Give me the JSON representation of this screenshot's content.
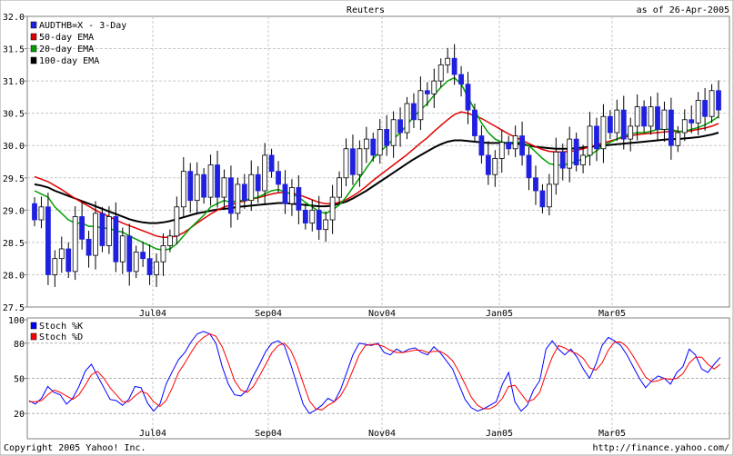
{
  "header": {
    "title": "Reuters",
    "date": "as of 26-Apr-2005"
  },
  "footer": {
    "copyright": "Copyright 2005 Yahoo! Inc.",
    "url": "http://finance.yahoo.com/"
  },
  "colors": {
    "candle_up": "#ffffff",
    "candle_down": "#2020e0",
    "ema50": "#e00000",
    "ema20": "#00a000",
    "ema100": "#000000",
    "stochK": "#0000ff",
    "stochD": "#ff0000"
  },
  "chart_data": [
    {
      "type": "candlestick",
      "x_ticks": [
        "Jul04",
        "Sep04",
        "Nov04",
        "Jan05",
        "Mar05"
      ],
      "y_ticks": [
        "27.5",
        "28.0",
        "28.5",
        "29.0",
        "29.5",
        "30.0",
        "30.5",
        "31.0",
        "31.5",
        "32.0"
      ],
      "ylim": [
        27.5,
        32.0
      ],
      "grid": true,
      "legend_position": "top-left",
      "legend": [
        "AUDTHB=X - 3-Day",
        "50-day EMA",
        "20-day EMA",
        "100-day EMA"
      ],
      "candles_open": [
        29.1,
        28.85,
        29.05,
        28.0,
        28.25,
        28.4,
        28.05,
        28.9,
        28.55,
        28.3,
        28.95,
        28.45,
        28.9,
        28.2,
        28.6,
        28.05,
        28.35,
        28.25,
        28.0,
        28.2,
        28.45,
        28.6,
        29.05,
        29.6,
        29.15,
        29.55,
        29.2,
        29.7,
        29.2,
        29.5,
        28.95,
        29.4,
        29.15,
        29.55,
        29.3,
        29.85,
        29.6,
        29.4,
        29.1,
        29.35,
        29.0,
        28.8,
        29.0,
        28.7,
        28.85,
        29.2,
        29.5,
        29.95,
        29.55,
        29.95,
        30.1,
        29.85,
        30.25,
        30.0,
        30.4,
        30.2,
        30.65,
        30.4,
        30.85,
        30.8,
        31.0,
        31.25,
        31.35,
        31.1,
        30.95,
        30.55,
        30.15,
        29.85,
        29.55,
        29.8,
        30.05,
        29.95,
        30.15,
        29.85,
        29.5,
        29.3,
        29.05,
        29.4,
        29.9,
        29.65,
        30.1,
        29.7,
        29.85,
        30.3,
        29.95,
        30.45,
        30.2,
        30.55,
        30.1,
        30.3,
        30.6,
        30.3,
        30.6,
        30.25,
        30.55,
        30.0,
        30.2,
        30.4,
        30.35,
        30.7,
        30.45,
        30.85
      ],
      "candles_close": [
        28.85,
        29.05,
        28.0,
        28.25,
        28.4,
        28.05,
        28.9,
        28.55,
        28.3,
        28.95,
        28.45,
        28.9,
        28.2,
        28.6,
        28.05,
        28.35,
        28.25,
        28.0,
        28.2,
        28.45,
        28.6,
        29.05,
        29.6,
        29.15,
        29.55,
        29.2,
        29.7,
        29.2,
        29.5,
        28.95,
        29.4,
        29.15,
        29.55,
        29.3,
        29.85,
        29.6,
        29.4,
        29.1,
        29.35,
        29.0,
        28.8,
        29.0,
        28.7,
        28.85,
        29.2,
        29.5,
        29.95,
        29.55,
        29.95,
        30.1,
        29.85,
        30.25,
        30.0,
        30.4,
        30.2,
        30.65,
        30.4,
        30.85,
        30.8,
        31.0,
        31.25,
        31.35,
        31.1,
        30.95,
        30.55,
        30.15,
        29.85,
        29.55,
        29.8,
        30.05,
        29.95,
        30.15,
        29.85,
        29.5,
        29.3,
        29.05,
        29.4,
        29.9,
        29.65,
        30.1,
        29.7,
        29.85,
        30.3,
        29.95,
        30.45,
        30.2,
        30.55,
        30.1,
        30.3,
        30.6,
        30.3,
        30.6,
        30.25,
        30.55,
        30.0,
        30.2,
        30.4,
        30.35,
        30.7,
        30.45,
        30.85,
        30.55
      ],
      "ema20": [
        29.3,
        29.25,
        29.2,
        29.05,
        28.95,
        28.85,
        28.8,
        28.8,
        28.75,
        28.75,
        28.72,
        28.72,
        28.68,
        28.66,
        28.6,
        28.55,
        28.5,
        28.45,
        28.4,
        28.38,
        28.4,
        28.48,
        28.6,
        28.72,
        28.82,
        28.92,
        29.05,
        29.1,
        29.15,
        29.12,
        29.15,
        29.15,
        29.18,
        29.2,
        29.25,
        29.3,
        29.32,
        29.28,
        29.25,
        29.2,
        29.12,
        29.05,
        28.98,
        28.95,
        29.0,
        29.08,
        29.2,
        29.35,
        29.5,
        29.65,
        29.8,
        29.9,
        30.0,
        30.1,
        30.2,
        30.32,
        30.45,
        30.55,
        30.65,
        30.78,
        30.9,
        31.0,
        31.05,
        30.95,
        30.75,
        30.55,
        30.35,
        30.2,
        30.1,
        30.05,
        30.05,
        30.05,
        30.05,
        30.0,
        29.9,
        29.8,
        29.72,
        29.7,
        29.7,
        29.72,
        29.75,
        29.8,
        29.85,
        29.92,
        30.0,
        30.05,
        30.1,
        30.15,
        30.18,
        30.2,
        30.2,
        30.22,
        30.25,
        30.25,
        30.25,
        30.22,
        30.22,
        30.25,
        30.28,
        30.32,
        30.38,
        30.45
      ],
      "ema50": [
        29.52,
        29.48,
        29.44,
        29.38,
        29.32,
        29.25,
        29.18,
        29.12,
        29.06,
        29.0,
        28.95,
        28.9,
        28.85,
        28.8,
        28.76,
        28.72,
        28.68,
        28.64,
        28.6,
        28.58,
        28.58,
        28.6,
        28.65,
        28.72,
        28.8,
        28.87,
        28.94,
        29.0,
        29.05,
        29.08,
        29.12,
        29.14,
        29.17,
        29.19,
        29.22,
        29.25,
        29.27,
        29.27,
        29.26,
        29.24,
        29.2,
        29.16,
        29.12,
        29.1,
        29.1,
        29.12,
        29.16,
        29.22,
        29.29,
        29.37,
        29.46,
        29.54,
        29.62,
        29.7,
        29.78,
        29.86,
        29.95,
        30.04,
        30.12,
        30.22,
        30.31,
        30.4,
        30.48,
        30.52,
        30.5,
        30.46,
        30.42,
        30.36,
        30.3,
        30.24,
        30.18,
        30.13,
        30.08,
        30.03,
        29.98,
        29.94,
        29.91,
        29.9,
        29.9,
        29.91,
        29.92,
        29.95,
        29.98,
        30.01,
        30.04,
        30.07,
        30.1,
        30.13,
        30.15,
        30.17,
        30.18,
        30.19,
        30.2,
        30.21,
        30.22,
        30.22,
        30.22,
        30.23,
        30.25,
        30.27,
        30.3,
        30.34
      ],
      "ema100": [
        29.4,
        29.38,
        29.35,
        29.3,
        29.26,
        29.22,
        29.18,
        29.14,
        29.1,
        29.06,
        29.02,
        28.98,
        28.94,
        28.9,
        28.86,
        28.83,
        28.81,
        28.8,
        28.8,
        28.81,
        28.83,
        28.86,
        28.89,
        28.92,
        28.95,
        28.97,
        28.99,
        29.01,
        29.02,
        29.03,
        29.05,
        29.06,
        29.07,
        29.08,
        29.09,
        29.1,
        29.11,
        29.11,
        29.1,
        29.09,
        29.08,
        29.07,
        29.06,
        29.06,
        29.07,
        29.1,
        29.13,
        29.18,
        29.24,
        29.3,
        29.37,
        29.44,
        29.51,
        29.58,
        29.65,
        29.72,
        29.79,
        29.85,
        29.91,
        29.97,
        30.02,
        30.06,
        30.08,
        30.08,
        30.07,
        30.06,
        30.05,
        30.04,
        30.04,
        30.04,
        30.04,
        30.03,
        30.02,
        30.0,
        29.98,
        29.97,
        29.96,
        29.95,
        29.95,
        29.95,
        29.96,
        29.97,
        29.98,
        29.99,
        30.0,
        30.01,
        30.02,
        30.03,
        30.04,
        30.05,
        30.06,
        30.07,
        30.08,
        30.09,
        30.1,
        30.1,
        30.11,
        30.12,
        30.13,
        30.15,
        30.17,
        30.2
      ]
    },
    {
      "type": "line",
      "y_ticks": [
        "20",
        "50",
        "80",
        "100"
      ],
      "ylim": [
        0,
        100
      ],
      "grid": true,
      "legend_position": "top-left",
      "series": [
        {
          "name": "Stoch %K",
          "values": [
            31,
            28,
            33,
            43,
            38,
            36,
            28,
            33,
            43,
            56,
            62,
            52,
            42,
            32,
            31,
            27,
            32,
            43,
            42,
            29,
            22,
            28,
            45,
            56,
            66,
            72,
            81,
            88,
            90,
            88,
            80,
            60,
            45,
            36,
            35,
            40,
            52,
            62,
            73,
            80,
            82,
            78,
            62,
            45,
            28,
            20,
            23,
            27,
            33,
            30,
            40,
            55,
            70,
            80,
            79,
            78,
            80,
            72,
            70,
            75,
            72,
            75,
            76,
            72,
            70,
            77,
            72,
            65,
            58,
            45,
            32,
            25,
            22,
            24,
            27,
            30,
            45,
            55,
            30,
            22,
            27,
            40,
            48,
            75,
            82,
            75,
            70,
            75,
            68,
            58,
            50,
            62,
            78,
            85,
            82,
            78,
            70,
            60,
            50,
            42,
            48,
            52,
            50,
            45,
            55,
            60,
            75,
            70,
            58,
            55,
            62,
            68
          ]
        },
        {
          "name": "Stoch %D",
          "values": [
            30,
            30,
            31,
            36,
            40,
            38,
            35,
            32,
            36,
            44,
            53,
            56,
            50,
            42,
            36,
            30,
            30,
            35,
            39,
            37,
            30,
            26,
            31,
            42,
            55,
            63,
            72,
            80,
            85,
            88,
            86,
            77,
            63,
            48,
            40,
            38,
            43,
            52,
            62,
            72,
            78,
            80,
            74,
            62,
            46,
            31,
            24,
            23,
            27,
            30,
            35,
            44,
            57,
            70,
            78,
            79,
            79,
            77,
            74,
            72,
            72,
            73,
            74,
            74,
            72,
            73,
            73,
            70,
            65,
            56,
            45,
            34,
            27,
            24,
            24,
            27,
            33,
            43,
            44,
            37,
            30,
            32,
            38,
            54,
            68,
            78,
            76,
            73,
            71,
            67,
            59,
            57,
            63,
            74,
            81,
            81,
            77,
            69,
            60,
            51,
            47,
            48,
            50,
            49,
            50,
            54,
            63,
            68,
            68,
            62,
            58,
            62
          ]
        }
      ],
      "x_ticks": [
        "Jul04",
        "Sep04",
        "Nov04",
        "Jan05",
        "Mar05"
      ]
    }
  ]
}
